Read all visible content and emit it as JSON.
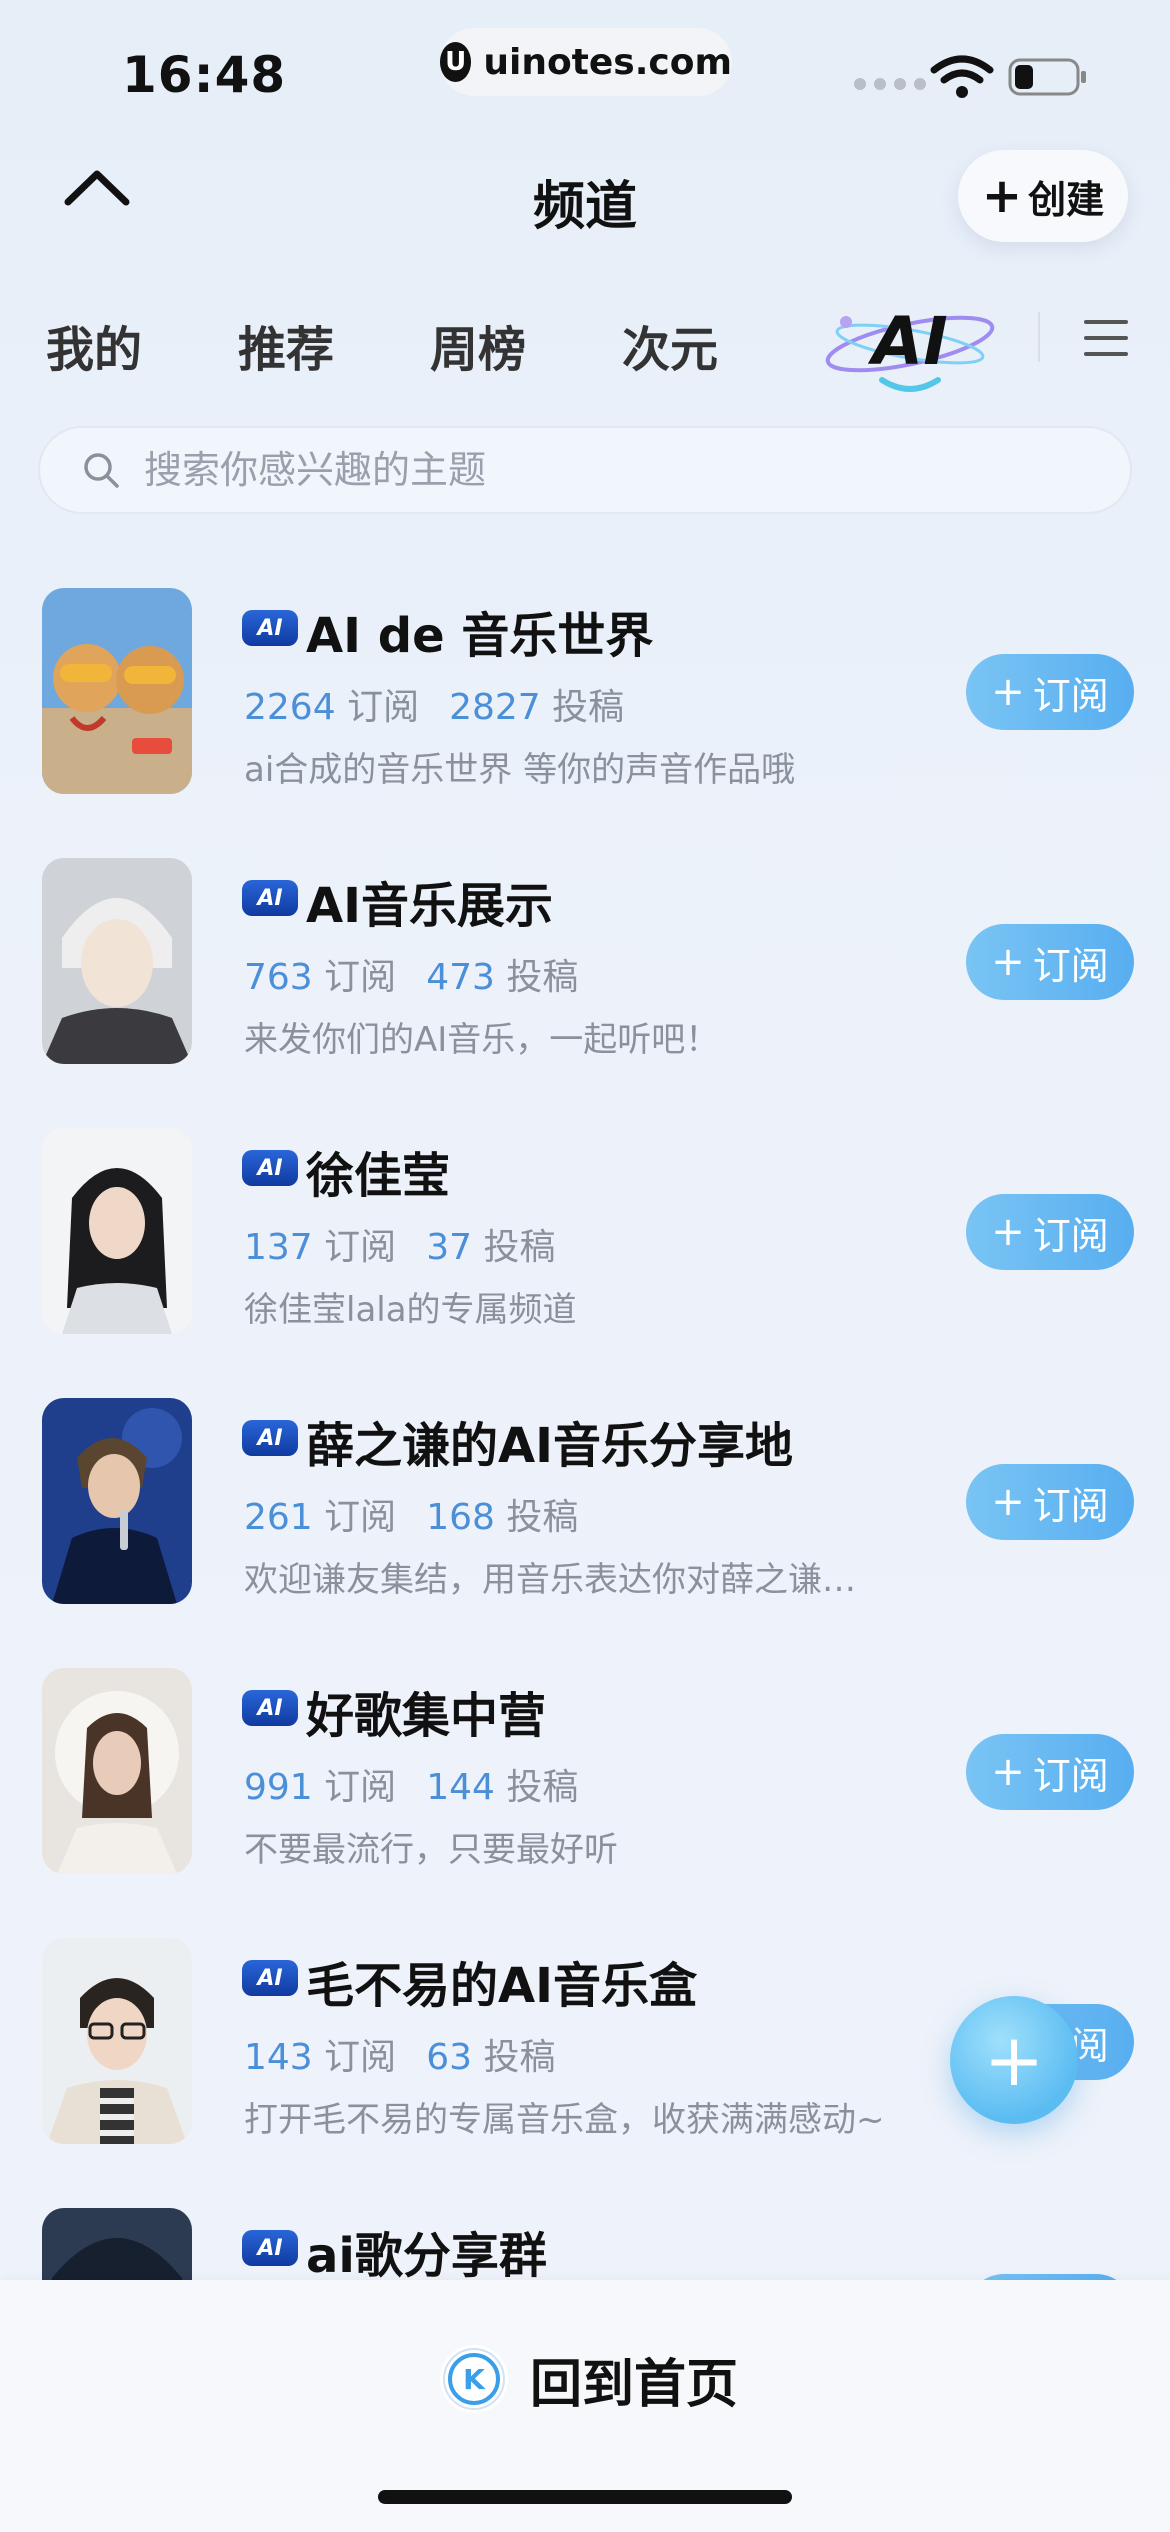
{
  "status": {
    "time": "16:48",
    "site": "uinotes.com",
    "site_logo": "U"
  },
  "header": {
    "title": "频道",
    "create_label": "创建"
  },
  "tabs": {
    "mine": "我的",
    "recommend": "推荐",
    "weekly": "周榜",
    "ciyuan": "次元",
    "ai": "AI"
  },
  "search": {
    "placeholder": "搜索你感兴趣的主题"
  },
  "labels": {
    "subscribe": "订阅",
    "subs_unit": "订阅",
    "posts_unit": "投稿",
    "ai_badge": "AI"
  },
  "channels": [
    {
      "name": "AI de 音乐世界",
      "subscribers": "2264",
      "posts": "2827",
      "desc": "ai合成的音乐世界 等你的声音作品哦"
    },
    {
      "name": "AI音乐展示",
      "subscribers": "763",
      "posts": "473",
      "desc": "来发你们的AI音乐，一起听吧！"
    },
    {
      "name": "徐佳莹",
      "subscribers": "137",
      "posts": "37",
      "desc": "徐佳莹lala的专属频道"
    },
    {
      "name": "薛之谦的AI音乐分享地",
      "subscribers": "261",
      "posts": "168",
      "desc": "欢迎谦友集结，用音乐表达你对薛之谦…"
    },
    {
      "name": "好歌集中营",
      "subscribers": "991",
      "posts": "144",
      "desc": "不要最流行，只要最好听"
    },
    {
      "name": "毛不易的AI音乐盒",
      "subscribers": "143",
      "posts": "63",
      "desc": "打开毛不易的专属音乐盒，收获满满感动~"
    },
    {
      "name": "ai歌分享群"
    }
  ],
  "bottom": {
    "home_label": "回到首页",
    "logo": "K"
  },
  "colors": {
    "accent": "#58aef0",
    "number": "#4a8fd8",
    "muted": "#8b919c"
  }
}
